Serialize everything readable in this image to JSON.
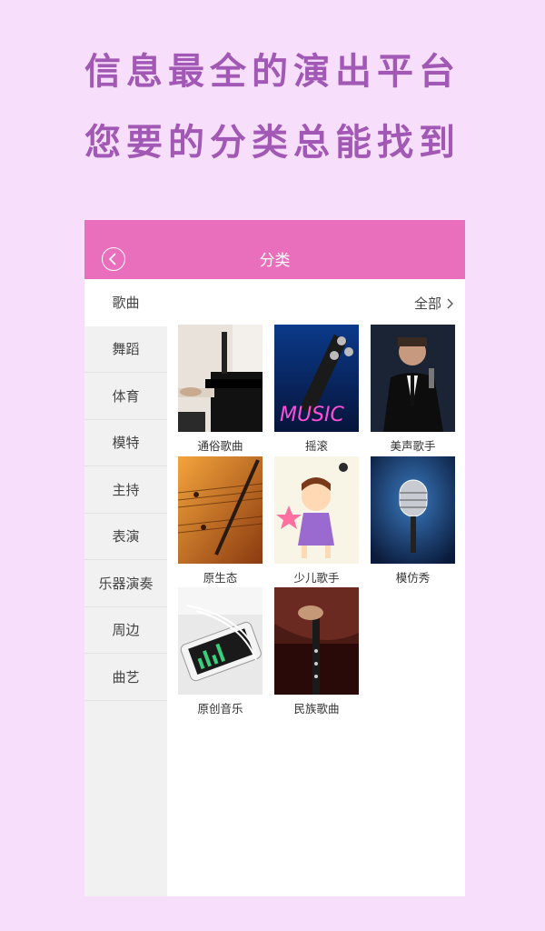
{
  "promo": {
    "line1": "信息最全的演出平台",
    "line2": "您要的分类总能找到"
  },
  "navbar": {
    "title": "分类",
    "back_icon": "chevron-left-circle-icon"
  },
  "sidebar": {
    "items": [
      {
        "label": "歌曲",
        "active": true
      },
      {
        "label": "舞蹈"
      },
      {
        "label": "体育"
      },
      {
        "label": "模特"
      },
      {
        "label": "主持"
      },
      {
        "label": "表演"
      },
      {
        "label": "乐器演奏"
      },
      {
        "label": "周边"
      },
      {
        "label": "曲艺"
      }
    ]
  },
  "content": {
    "all_label": "全部",
    "categories": [
      {
        "label": "通俗歌曲"
      },
      {
        "label": "摇滚"
      },
      {
        "label": "美声歌手"
      },
      {
        "label": "原生态"
      },
      {
        "label": "少儿歌手"
      },
      {
        "label": "模仿秀"
      },
      {
        "label": "原创音乐"
      },
      {
        "label": "民族歌曲"
      }
    ]
  },
  "colors": {
    "page_bg": "#f7dffb",
    "headline": "#a259b5",
    "navbar": "#e96fbd"
  }
}
